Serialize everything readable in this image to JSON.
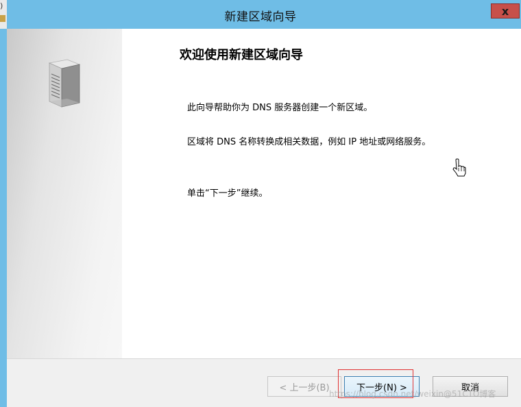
{
  "window": {
    "title": "新建区域向导",
    "close_label": "x"
  },
  "wizard": {
    "heading": "欢迎使用新建区域向导",
    "paragraphs": [
      "此向导帮助你为 DNS 服务器创建一个新区域。",
      "区域将 DNS 名称转换成相关数据，例如 IP 地址或网络服务。",
      "单击“下一步”继续。"
    ]
  },
  "buttons": {
    "back": "< 上一步(B)",
    "next": "下一步(N) >",
    "cancel": "取消"
  },
  "watermark": "https://blog.csdn.net/weixin@51CTO博客",
  "icons": {
    "side": "server-icon",
    "pointer": "hand-cursor-icon"
  },
  "colors": {
    "titlebar": "#6fbde6",
    "close": "#c7504a",
    "highlight": "#e03030"
  }
}
